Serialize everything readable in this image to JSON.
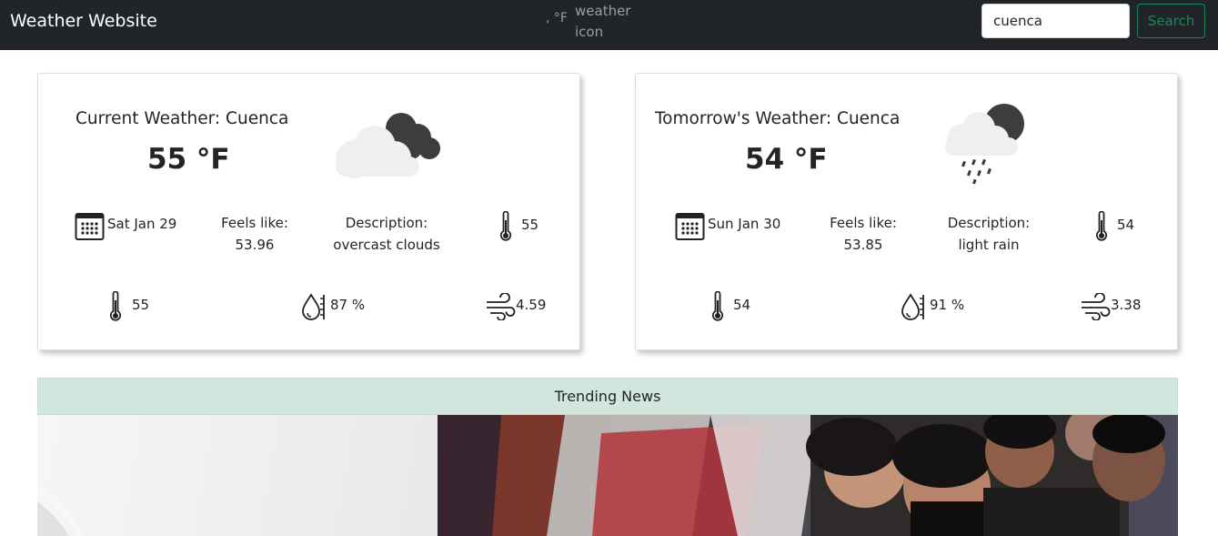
{
  "navbar": {
    "brand": "Weather Website",
    "unit_text": ", °F",
    "icon_alt": "weather icon",
    "search_value": "cuenca",
    "search_button": "Search"
  },
  "today": {
    "title": "Current Weather: Cuenca",
    "temp": "55 °F",
    "date": "Sat Jan 29",
    "feels_label": "Feels like:",
    "feels_value": "53.96",
    "desc_label": "Description:",
    "desc_value": "overcast clouds",
    "temp_small": "55",
    "temp_small_2": "55",
    "humidity": "87 %",
    "wind": "4.59",
    "icon": "overcast-clouds-icon"
  },
  "tomorrow": {
    "title": "Tomorrow's Weather: Cuenca",
    "temp": "54 °F",
    "date": "Sun Jan 30",
    "feels_label": "Feels like:",
    "feels_value": "53.85",
    "desc_label": "Description:",
    "desc_value": "light rain",
    "temp_small": "54",
    "temp_small_2": "54",
    "humidity": "91 %",
    "wind": "3.38",
    "icon": "light-rain-icon"
  },
  "news": {
    "header": "Trending News"
  },
  "colors": {
    "navbar_bg": "#212529",
    "search_accent": "#198754",
    "news_header_bg": "#d1e7dd"
  }
}
